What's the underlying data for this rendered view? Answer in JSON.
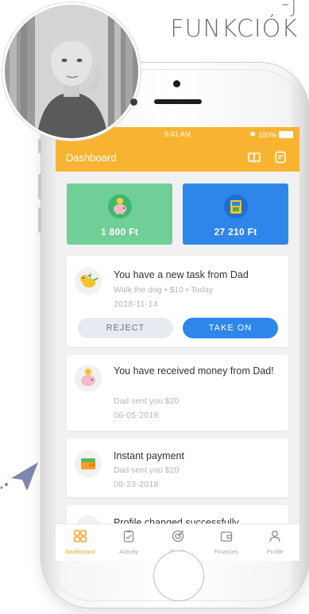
{
  "headline": {
    "line1": "-j",
    "line2": "FUNKCIÓK"
  },
  "statusbar": {
    "signal": "•••• ",
    "time": "9:41 AM",
    "bt": "✱",
    "battery": "100%"
  },
  "navbar": {
    "title": "Dashboard"
  },
  "tiles": [
    {
      "amount": "1 800 Ft",
      "color": "#6fcf97"
    },
    {
      "amount": "27 210 Ft",
      "color": "#2e86ea"
    }
  ],
  "cards": {
    "task": {
      "title": "You have a new task from Dad",
      "sub": "Walk the dog  •  $10  •  Today",
      "date": "2018-11-14",
      "reject": "REJECT",
      "take": "TAKE ON"
    },
    "money": {
      "title": "You have received money from Dad!",
      "sub": "Dad sent you $20",
      "date": "06-05-2018"
    },
    "payment": {
      "title": "Instant payment",
      "sub": "Dad sent you $20",
      "date": "08-23-2018"
    },
    "profile": {
      "title": "Profile changed successfully"
    }
  },
  "tabs": [
    {
      "label": "Dashboard",
      "icon": "dashboard-icon"
    },
    {
      "label": "Activity",
      "icon": "activity-icon"
    },
    {
      "label": "Goals",
      "icon": "goals-icon"
    },
    {
      "label": "Finances",
      "icon": "finances-icon"
    },
    {
      "label": "Profile",
      "icon": "profile-icon"
    }
  ],
  "colors": {
    "accent": "#f8b431",
    "blue": "#2e86ea",
    "green": "#6fcf97",
    "active_tab": "#f5a623"
  }
}
